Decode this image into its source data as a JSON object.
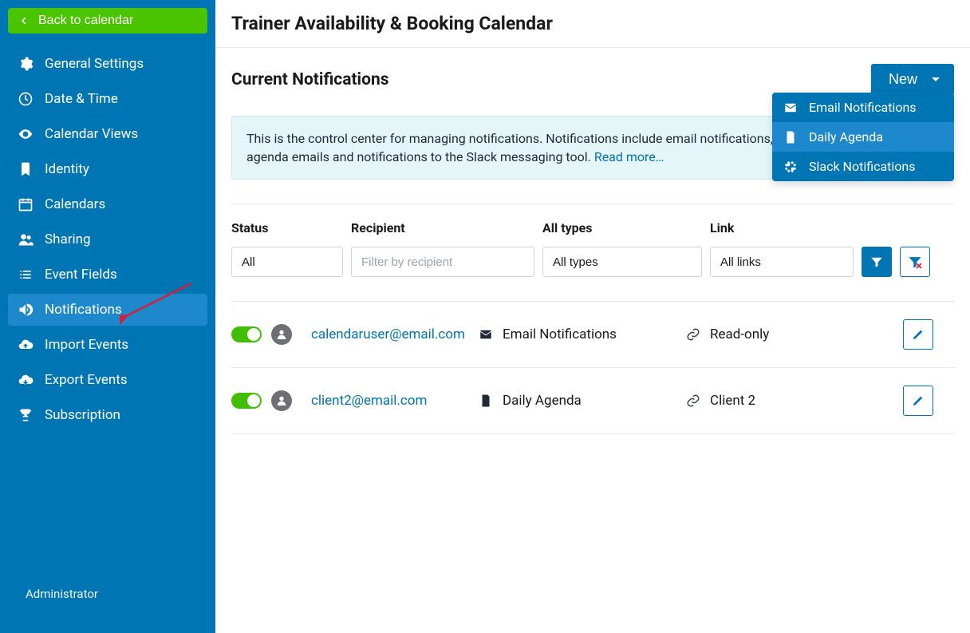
{
  "sidebar": {
    "back_label": "Back to calendar",
    "items": [
      {
        "label": "General Settings",
        "icon": "gear-icon"
      },
      {
        "label": "Date & Time",
        "icon": "clock-icon"
      },
      {
        "label": "Calendar Views",
        "icon": "eye-icon"
      },
      {
        "label": "Identity",
        "icon": "bookmark-icon"
      },
      {
        "label": "Calendars",
        "icon": "calendar-icon"
      },
      {
        "label": "Sharing",
        "icon": "users-icon"
      },
      {
        "label": "Event Fields",
        "icon": "list-icon"
      },
      {
        "label": "Notifications",
        "icon": "speaker-icon",
        "active": true
      },
      {
        "label": "Import Events",
        "icon": "upload-icon"
      },
      {
        "label": "Export Events",
        "icon": "download-icon"
      },
      {
        "label": "Subscription",
        "icon": "trophy-icon"
      }
    ],
    "footer": "Administrator"
  },
  "header": {
    "title": "Trainer Availability & Booking Calendar"
  },
  "section": {
    "title": "Current Notifications",
    "new_button": "New",
    "dropdown": [
      {
        "label": "Email Notifications"
      },
      {
        "label": "Daily Agenda",
        "hover": true
      },
      {
        "label": "Slack Notifications"
      }
    ]
  },
  "banner": {
    "text": "This is the control center for managing notifications. Notifications include email notifications, SMS notifications, daily agenda emails and notifications to the Slack messaging tool. ",
    "read_more": "Read more…"
  },
  "filters": {
    "status_label": "Status",
    "status_value": "All",
    "recipient_label": "Recipient",
    "recipient_placeholder": "Filter by recipient",
    "types_label": "All types",
    "types_value": "All types",
    "link_label": "Link",
    "link_value": "All links"
  },
  "rows": [
    {
      "enabled": true,
      "recipient": "calendaruser@email.com",
      "type": "Email Notifications",
      "link": "Read-only"
    },
    {
      "enabled": true,
      "recipient": "client2@email.com",
      "type": "Daily Agenda",
      "link": "Client 2"
    }
  ],
  "colors": {
    "brand": "#0075b3",
    "sidebar_bg": "#0075b3",
    "accent_green": "#4bc400",
    "toggle_green": "#3fbf00",
    "info_bg": "#e5f6f9",
    "arrow": "#d71d3a"
  }
}
